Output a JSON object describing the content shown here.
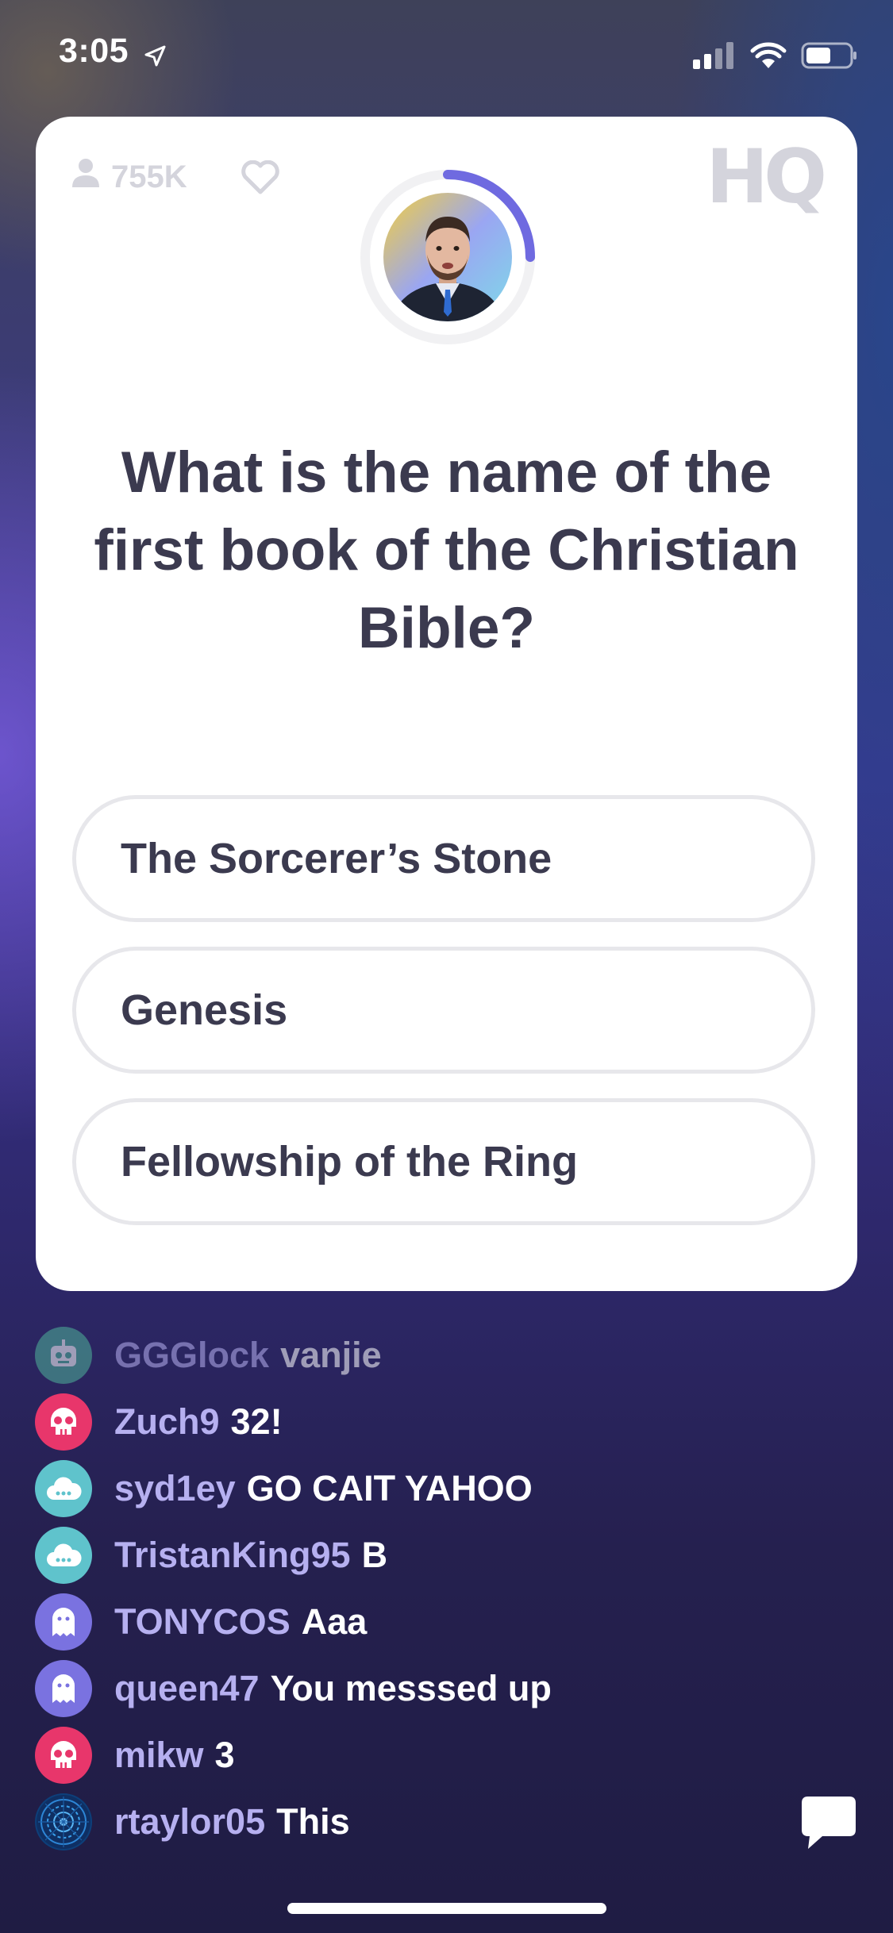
{
  "status_bar": {
    "time": "3:05"
  },
  "card": {
    "player_count": "755K",
    "logo": "HQ",
    "question": "What is the name of the first book of the Christian Bible?",
    "answers": [
      "The Sorcerer’s Stone",
      "Genesis",
      "Fellowship of the Ring"
    ],
    "timer_progress": 0.25,
    "timer_color": "#6f6ae0"
  },
  "chat": [
    {
      "user": "GGGlock",
      "message": "vanjie",
      "avatar": "robot-icon",
      "avatar_color": "#4fb39a"
    },
    {
      "user": "Zuch9",
      "message": "32!",
      "avatar": "skull-icon",
      "avatar_color": "#e8366b"
    },
    {
      "user": "syd1ey",
      "message": "GO CAIT YAHOO",
      "avatar": "cloud-icon",
      "avatar_color": "#5fc3cc"
    },
    {
      "user": "TristanKing95",
      "message": "B",
      "avatar": "cloud-icon",
      "avatar_color": "#5fc3cc"
    },
    {
      "user": "TONYCOS",
      "message": "Aaa",
      "avatar": "ghost-icon",
      "avatar_color": "#7a72e0"
    },
    {
      "user": "queen47",
      "message": "You messsed up",
      "avatar": "ghost-icon",
      "avatar_color": "#7a72e0"
    },
    {
      "user": "mikw",
      "message": "3",
      "avatar": "skull-icon",
      "avatar_color": "#e8366b"
    },
    {
      "user": "rtaylor05",
      "message": "This",
      "avatar": "mandala-avatar",
      "avatar_color": "#1a5fb0"
    }
  ],
  "colors": {
    "card_text": "#3b3a4f",
    "chat_username": "#b6b0f0",
    "muted_gray": "#d4d4dc"
  }
}
